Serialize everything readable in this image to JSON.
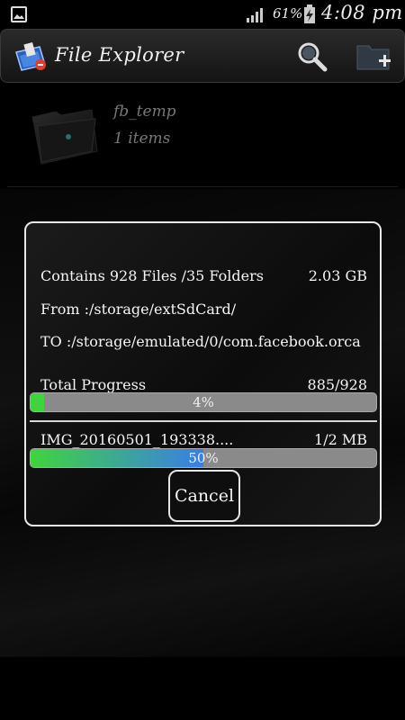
{
  "status_bar": {
    "battery_percent": "61%",
    "time": "4:08 pm",
    "icons": [
      "gallery-notification-icon",
      "signal-icon",
      "battery-charging-icon"
    ]
  },
  "header": {
    "title": "File Explorer",
    "icons": [
      "app-icon",
      "search-icon",
      "new-folder-icon"
    ]
  },
  "folder": {
    "name": "fb_temp",
    "count": "1 items"
  },
  "dialog": {
    "contains": "Contains 928 Files /35 Folders",
    "size": "2.03 GB",
    "from": "From :/storage/extSdCard/",
    "to": "TO :/storage/emulated/0/com.facebook.orca",
    "total_label": "Total Progress",
    "total_count": "885/928",
    "total_percent_text": "4%",
    "total_progress": 0.04,
    "file_name": "IMG_20160501_193338....",
    "file_size": "1/2 MB",
    "file_percent_text": "50%",
    "file_progress": 0.5,
    "cancel_label": "Cancel"
  },
  "colors": {
    "progress_green": "#3fd43f",
    "progress_blue": "#3a7ee6"
  }
}
